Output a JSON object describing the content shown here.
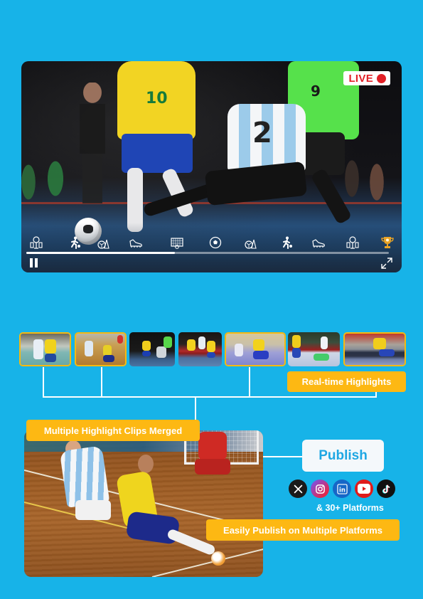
{
  "player": {
    "live_label": "LIVE",
    "jersey_numbers": {
      "yellow": "10",
      "white": "2",
      "green": "9"
    },
    "progress_fraction": 0.41,
    "controls": {
      "pause": "pause-icon",
      "fullscreen": "expand-icon"
    },
    "event_markers": [
      {
        "icon": "team-lineup-icon"
      },
      {
        "icon": "player-kick-icon"
      },
      {
        "icon": "ball-cone-icon"
      },
      {
        "icon": "football-boot-icon"
      },
      {
        "icon": "goal-net-icon"
      },
      {
        "icon": "football-icon"
      },
      {
        "icon": "ball-cone-icon"
      },
      {
        "icon": "player-kick-icon"
      },
      {
        "icon": "football-boot-icon"
      },
      {
        "icon": "team-lineup-icon"
      },
      {
        "icon": "trophy-icon"
      }
    ]
  },
  "thumbnails": [
    {
      "selected": true,
      "theme": "teal-court"
    },
    {
      "selected": true,
      "theme": "wood-court"
    },
    {
      "selected": false,
      "theme": "dark-arena"
    },
    {
      "selected": false,
      "theme": "red-boards"
    },
    {
      "selected": true,
      "theme": "purple-court"
    },
    {
      "selected": false,
      "theme": "goalkeeper-save"
    },
    {
      "selected": true,
      "theme": "adidas-boards"
    }
  ],
  "labels": {
    "realtime_highlights": "Real-time Highlights",
    "clips_merged": "Multiple Highlight Clips Merged",
    "easily_publish": "Easily Publish on Multiple Platforms"
  },
  "publish": {
    "button_label": "Publish",
    "platforms": [
      {
        "name": "X",
        "icon": "x-twitter-icon",
        "glyph": "𝕏",
        "color": "#1a1a1a"
      },
      {
        "name": "Instagram",
        "icon": "instagram-icon",
        "glyph": "",
        "color": "#b33bd6"
      },
      {
        "name": "LinkedIn",
        "icon": "linkedin-icon",
        "glyph": "in",
        "color": "#1667c7"
      },
      {
        "name": "YouTube",
        "icon": "youtube-icon",
        "glyph": "▶",
        "color": "#e01b1b"
      },
      {
        "name": "TikTok",
        "icon": "tiktok-icon",
        "glyph": "♪",
        "color": "#111111"
      }
    ],
    "more_platforms": "& 30+ Platforms"
  },
  "colors": {
    "background": "#17b3e8",
    "accent_tag": "#fdb813",
    "live_red": "#e21f26",
    "publish_text": "#1ea7e3"
  }
}
